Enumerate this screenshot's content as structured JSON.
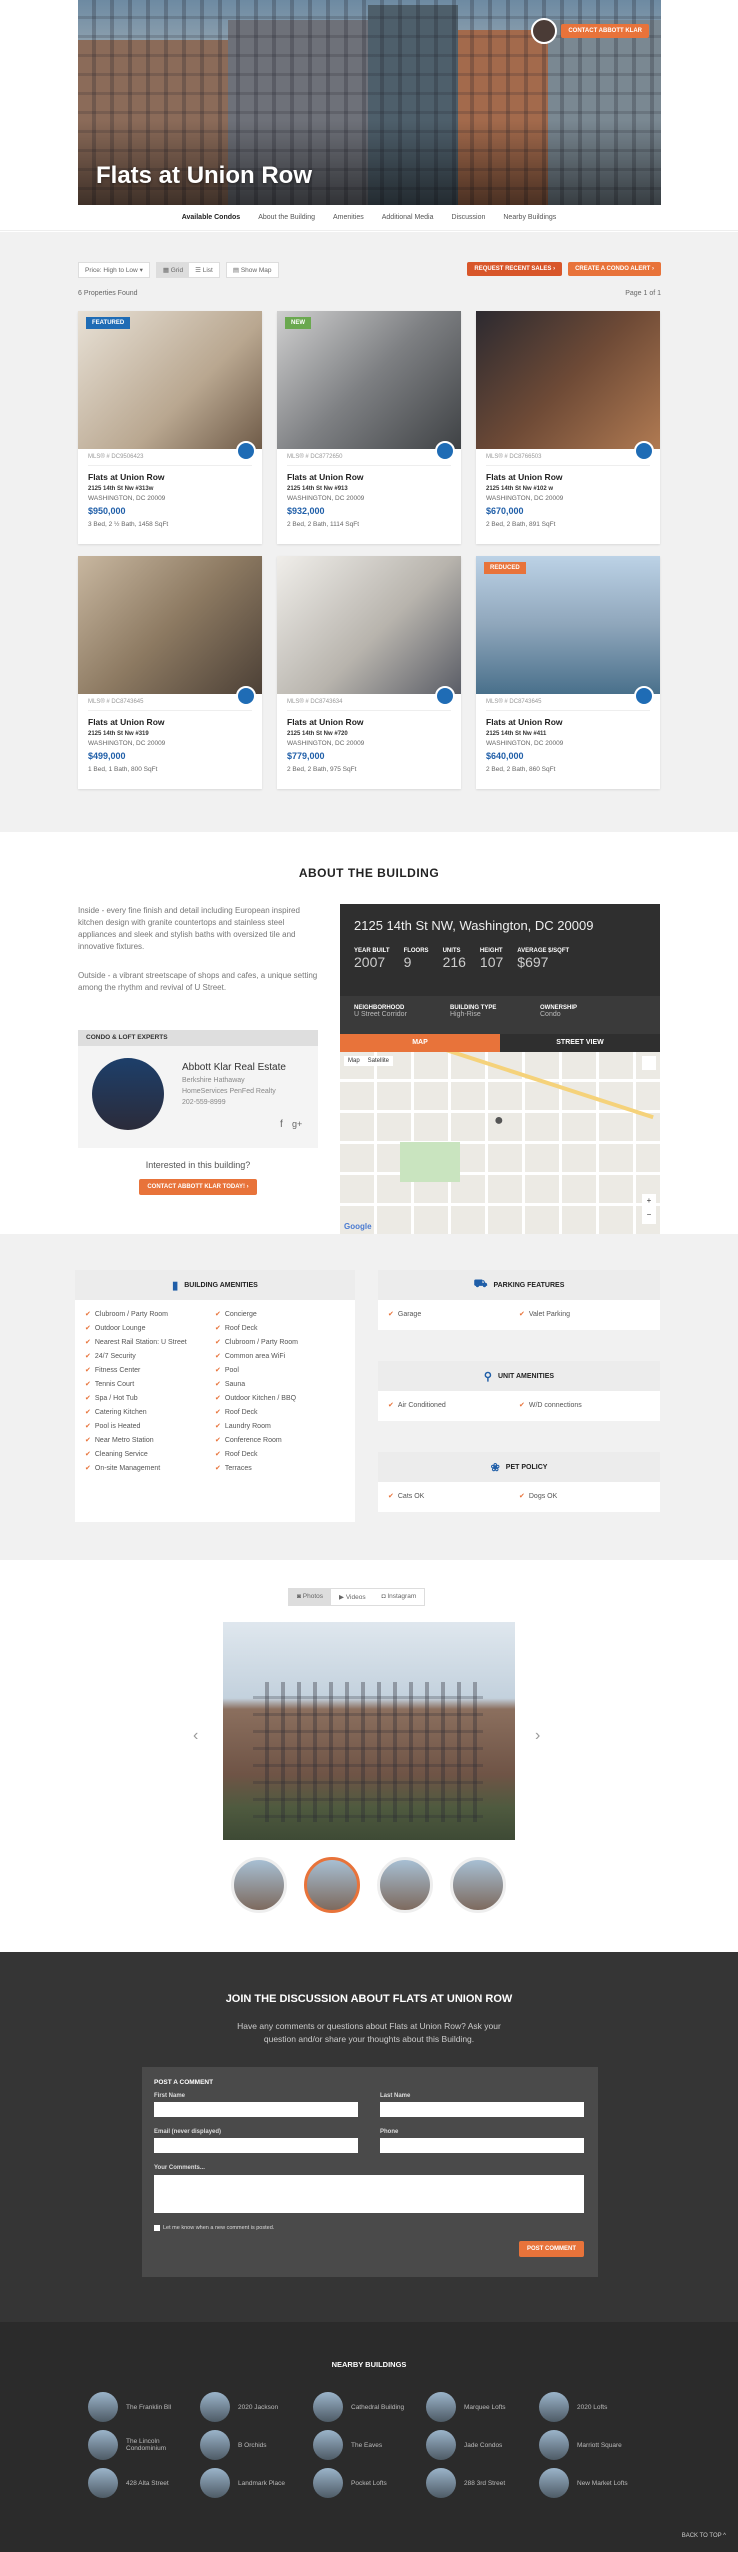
{
  "building": {
    "name": "Flats at Union Row"
  },
  "hero": {
    "cta": "CONTACT ABBOTT KLAR"
  },
  "subnav": [
    "Available Condos",
    "About the Building",
    "Amenities",
    "Additional Media",
    "Discussion",
    "Nearby Buildings"
  ],
  "toolbar": {
    "sort": "Price: High to Low",
    "grid": "Grid",
    "list": "List",
    "map": "Show Map",
    "alerts": "REQUEST RECENT SALES",
    "condo_alert": "CREATE A CONDO ALERT"
  },
  "results": {
    "found": "6 Properties Found",
    "page": "Page 1 of 1"
  },
  "listings": [
    {
      "badge": "FEATURED",
      "mls": "MLS® # DC9506423",
      "title": "Flats at Union Row",
      "addr": "2125 14th St Nw #313w",
      "city": "WASHINGTON, DC 20009",
      "price": "$950,000",
      "meta": "3 Bed, 2 ½ Bath, 1458 SqFt"
    },
    {
      "badge": "NEW",
      "mls": "MLS® # DC8772650",
      "title": "Flats at Union Row",
      "addr": "2125 14th St Nw #913",
      "city": "WASHINGTON, DC 20009",
      "price": "$932,000",
      "meta": "2 Bed, 2 Bath, 1114 SqFt"
    },
    {
      "badge": "",
      "mls": "MLS® # DC8766503",
      "title": "Flats at Union Row",
      "addr": "2125 14th St Nw #102 w",
      "city": "WASHINGTON, DC 20009",
      "price": "$670,000",
      "meta": "2 Bed, 2 Bath, 891 SqFt"
    },
    {
      "badge": "",
      "mls": "MLS® # DC8743645",
      "title": "Flats at Union Row",
      "addr": "2125 14th St Nw #319",
      "city": "WASHINGTON, DC 20009",
      "price": "$499,000",
      "meta": "1 Bed, 1 Bath, 800 SqFt"
    },
    {
      "badge": "",
      "mls": "MLS® # DC8743634",
      "title": "Flats at Union Row",
      "addr": "2125 14th St Nw #720",
      "city": "WASHINGTON, DC 20009",
      "price": "$779,000",
      "meta": "2 Bed, 2 Bath, 975 SqFt"
    },
    {
      "badge": "REDUCED",
      "mls": "MLS® # DC8743645",
      "title": "Flats at Union Row",
      "addr": "2125 14th St Nw #411",
      "city": "WASHINGTON, DC 20009",
      "price": "$640,000",
      "meta": "2 Bed, 2 Bath, 860 SqFt"
    }
  ],
  "about": {
    "title": "ABOUT THE BUILDING",
    "p1": "Inside - every fine finish and detail including European inspired kitchen design with granite countertops and stainless steel appliances and sleek and stylish baths with oversized tile and innovative fixtures.",
    "p2": "Outside - a vibrant streetscape of shops and cafes, a unique setting among the rhythm and revival of U Street.",
    "experts_head": "CONDO & LOFT EXPERTS",
    "agent_name": "Abbott Klar Real Estate",
    "agent_co": "Berkshire Hathaway",
    "agent_co2": "HomeServices PenFed Realty",
    "agent_phone": "202-559-8999",
    "interested": "Interested in this building?",
    "contact_btn": "CONTACT ABBOTT KLAR TODAY!",
    "address": "2125 14th St NW, Washington, DC 20009",
    "stats": [
      {
        "l": "YEAR BUILT",
        "v": "2007"
      },
      {
        "l": "FLOORS",
        "v": "9"
      },
      {
        "l": "UNITS",
        "v": "216"
      },
      {
        "l": "HEIGHT",
        "v": "107"
      },
      {
        "l": "AVERAGE $/SQFT",
        "v": "$697"
      }
    ],
    "info": [
      {
        "l": "NEIGHBORHOOD",
        "v": "U Street Corridor"
      },
      {
        "l": "BUILDING TYPE",
        "v": "High-Rise"
      },
      {
        "l": "OWNERSHIP",
        "v": "Condo"
      }
    ],
    "map_tab": "MAP",
    "street_tab": "STREET VIEW",
    "map_btn": "Map",
    "sat_btn": "Satellite",
    "google": "Google"
  },
  "amenities": {
    "building_title": "BUILDING AMENITIES",
    "building": [
      "Clubroom / Party Room",
      "Concierge",
      "Outdoor Lounge",
      "Roof Deck",
      "Nearest Rail Station: U Street",
      "Clubroom / Party Room",
      "24/7 Security",
      "Common area WiFi",
      "Fitness Center",
      "Pool",
      "Tennis Court",
      "Sauna",
      "Spa / Hot Tub",
      "Outdoor Kitchen / BBQ",
      "Catering Kitchen",
      "Roof Deck",
      "Pool is Heated",
      "Laundry Room",
      "Near Metro Station",
      "Conference Room",
      "Cleaning Service",
      "Roof Deck",
      "On-site Management",
      "Terraces"
    ],
    "parking_title": "PARKING FEATURES",
    "parking": [
      "Garage",
      "Valet Parking"
    ],
    "unit_title": "UNIT AMENITIES",
    "unit": [
      "Air Conditioned",
      "W/D connections"
    ],
    "pet_title": "PET POLICY",
    "pet": [
      "Cats OK",
      "Dogs OK"
    ]
  },
  "media": {
    "tabs": [
      "Photos",
      "Videos",
      "Instagram"
    ]
  },
  "discussion": {
    "title": "JOIN THE DISCUSSION ABOUT FLATS AT UNION ROW",
    "sub": "Have any comments or questions about Flats at Union Row? Ask your question and/or share your thoughts about this Building.",
    "form_title": "POST A COMMENT",
    "first": "First Name",
    "last": "Last Name",
    "email": "Email (never displayed)",
    "phone": "Phone",
    "comments": "Your Comments...",
    "notify": "Let me know when a new comment is posted.",
    "submit": "POST COMMENT"
  },
  "nearby": {
    "title": "NEARBY BUILDINGS",
    "items": [
      "The Franklin Bll",
      "2020 Jackson",
      "Cathedral Building",
      "Marquee Lofts",
      "2020 Lofts",
      "The Lincoln Condominium",
      "B Orchids",
      "The Eaves",
      "Jade Condos",
      "Marriott Square",
      "428 Alta Street",
      "Landmark Place",
      "Pocket Lofts",
      "288 3rd Street",
      "New Market Lofts"
    ],
    "back": "BACK TO TOP"
  }
}
